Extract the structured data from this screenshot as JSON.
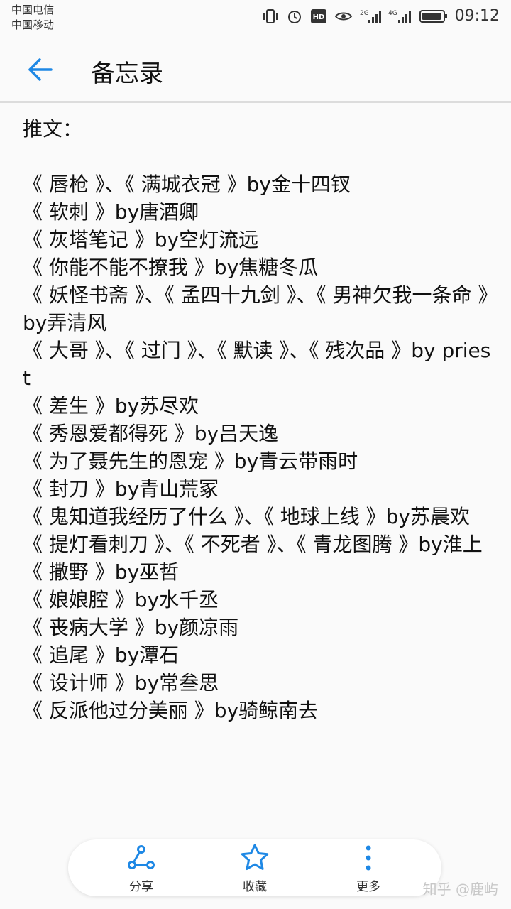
{
  "status_bar": {
    "carrier_1": "中国电信",
    "carrier_2": "中国移动",
    "network_1": "2G",
    "network_2": "4G",
    "time": "09:12",
    "icons": [
      "vibrate-icon",
      "alarm-icon",
      "hd-icon",
      "eye-icon",
      "signal-icon",
      "battery-icon"
    ]
  },
  "app_bar": {
    "title": "备忘录",
    "accent_color": "#1e88e5"
  },
  "note": {
    "heading": "推文：",
    "lines": [
      "《 唇枪 》、《 满城衣冠 》by金十四钗",
      "《 软刺 》by唐酒卿",
      "《 灰塔笔记 》by空灯流远",
      "《 你能不能不撩我 》by焦糖冬瓜",
      "《 妖怪书斋 》、《 孟四十九剑 》、《 男神欠我一条命 》by弄清风",
      "《 大哥 》、《 过门 》、《 默读 》、《 残次品 》by priest",
      "《 差生 》by苏尽欢",
      "《 秀恩爱都得死 》by吕天逸",
      "《 为了聂先生的恩宠 》by青云带雨时",
      "《 封刀 》by青山荒冢",
      "《 鬼知道我经历了什么 》、《 地球上线 》by苏晨欢",
      "《 提灯看刺刀 》、《 不死者 》、《 青龙图腾 》by淮上",
      "《 撒野 》by巫哲",
      "《 娘娘腔 》by水千丞",
      "《 丧病大学 》by颜凉雨",
      "《 追尾 》by潭石",
      "《 设计师 》by常叁思",
      "《 反派他过分美丽 》by骑鲸南去"
    ]
  },
  "bottom_bar": {
    "share_label": "分享",
    "favorite_label": "收藏",
    "more_label": "更多"
  },
  "watermark": "知乎 @鹿屿"
}
